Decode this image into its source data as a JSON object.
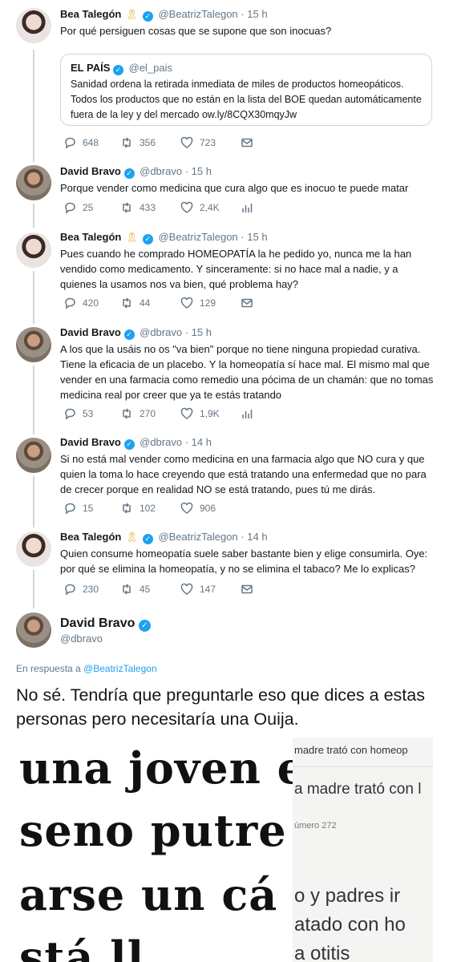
{
  "tweets": [
    {
      "name": "Bea Talegón",
      "handle": "@BeatrizTalegon",
      "time": "15 h",
      "text": "Por qué persiguen cosas que se supone que son inocuas?",
      "quote": {
        "name": "EL PAÍS",
        "handle": "@el_pais",
        "text": "Sanidad ordena la retirada inmediata de miles de productos homeopáticos. Todos los productos que no están en la lista del BOE quedan automáticamente fuera de la ley y del mercado ow.ly/8CQX30mqyJw"
      },
      "replies": "648",
      "retweets": "356",
      "likes": "723"
    },
    {
      "name": "David Bravo",
      "handle": "@dbravo",
      "time": "15 h",
      "text": "Porque vender como medicina que cura algo que es inocuo te puede matar",
      "replies": "25",
      "retweets": "433",
      "likes": "2,4K"
    },
    {
      "name": "Bea Talegón",
      "handle": "@BeatrizTalegon",
      "time": "15 h",
      "text": "Pues cuando he comprado HOMEOPATÍA la he pedido yo, nunca me la han vendido como medicamento. Y sinceramente: si no hace mal a nadie, y a quienes la usamos nos va bien, qué problema hay?",
      "replies": "420",
      "retweets": "44",
      "likes": "129"
    },
    {
      "name": "David Bravo",
      "handle": "@dbravo",
      "time": "15 h",
      "text": "A los que la usáis no os \"va bien\" porque no tiene ninguna propiedad curativa. Tiene la eficacia de un placebo. Y la homeopatía sí hace mal. El mismo mal que vender en una farmacia como remedio una pócima de un chamán: que no tomas medicina real por creer que ya te estás tratando",
      "replies": "53",
      "retweets": "270",
      "likes": "1,9K"
    },
    {
      "name": "David Bravo",
      "handle": "@dbravo",
      "time": "14 h",
      "text": "Si no está mal vender como medicina en una farmacia algo que NO cura y que quien la toma lo hace creyendo que está tratando una enfermedad que no para de crecer porque en realidad NO se está tratando, pues tú me dirás.",
      "replies": "15",
      "retweets": "102",
      "likes": "906"
    },
    {
      "name": "Bea Talegón",
      "handle": "@BeatrizTalegon",
      "time": "14 h",
      "text": "Quien consume homeopatía suele saber bastante bien y elige consumirla. Oye: por qué se elimina la homeopatía, y no se elimina el tabaco? Me lo explicas?",
      "replies": "230",
      "retweets": "45",
      "likes": "147"
    }
  ],
  "main": {
    "name": "David Bravo",
    "handle": "@dbravo",
    "reply_prefix": "En respuesta a",
    "reply_to": "@BeatrizTalegon",
    "text": "No sé. Tendría que preguntarle eso que dices a estas personas pero necesitaría una Ouija.",
    "image": {
      "left_lines": [
        "una joven e",
        "seno putre",
        "arse un cá",
        "stá ll"
      ],
      "right_lines": [
        "madre trató con homeop",
        "a madre trató con l",
        "úmero 272",
        "o y padres ir",
        "atado con ho",
        "a otitis"
      ]
    }
  },
  "icons": {
    "reply": "reply-icon",
    "retweet": "retweet-icon",
    "like": "heart-icon",
    "dm": "envelope-icon",
    "analytics": "analytics-icon",
    "verified": "verified-badge-icon",
    "ribbon": "yellow-ribbon-icon"
  },
  "colors": {
    "accent": "#1da1f2",
    "muted": "#657786",
    "line": "#ccd6dd",
    "ribbon": "#e0a50d"
  }
}
